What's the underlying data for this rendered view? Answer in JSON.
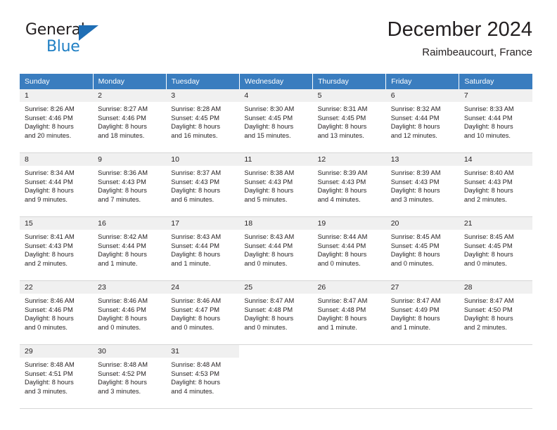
{
  "brand": {
    "name_top": "General",
    "name_bottom": "Blue",
    "triangle_color": "#1f6eb5",
    "blue_color": "#1f7fc4"
  },
  "header": {
    "title": "December 2024",
    "location": "Raimbeaucourt, France"
  },
  "calendar": {
    "header_bg": "#3a7dbf",
    "daynum_bg": "#f0f0f0",
    "weekdays": [
      "Sunday",
      "Monday",
      "Tuesday",
      "Wednesday",
      "Thursday",
      "Friday",
      "Saturday"
    ],
    "weeks": [
      [
        {
          "day": "1",
          "sunrise": "Sunrise: 8:26 AM",
          "sunset": "Sunset: 4:46 PM",
          "daylight1": "Daylight: 8 hours",
          "daylight2": "and 20 minutes."
        },
        {
          "day": "2",
          "sunrise": "Sunrise: 8:27 AM",
          "sunset": "Sunset: 4:46 PM",
          "daylight1": "Daylight: 8 hours",
          "daylight2": "and 18 minutes."
        },
        {
          "day": "3",
          "sunrise": "Sunrise: 8:28 AM",
          "sunset": "Sunset: 4:45 PM",
          "daylight1": "Daylight: 8 hours",
          "daylight2": "and 16 minutes."
        },
        {
          "day": "4",
          "sunrise": "Sunrise: 8:30 AM",
          "sunset": "Sunset: 4:45 PM",
          "daylight1": "Daylight: 8 hours",
          "daylight2": "and 15 minutes."
        },
        {
          "day": "5",
          "sunrise": "Sunrise: 8:31 AM",
          "sunset": "Sunset: 4:45 PM",
          "daylight1": "Daylight: 8 hours",
          "daylight2": "and 13 minutes."
        },
        {
          "day": "6",
          "sunrise": "Sunrise: 8:32 AM",
          "sunset": "Sunset: 4:44 PM",
          "daylight1": "Daylight: 8 hours",
          "daylight2": "and 12 minutes."
        },
        {
          "day": "7",
          "sunrise": "Sunrise: 8:33 AM",
          "sunset": "Sunset: 4:44 PM",
          "daylight1": "Daylight: 8 hours",
          "daylight2": "and 10 minutes."
        }
      ],
      [
        {
          "day": "8",
          "sunrise": "Sunrise: 8:34 AM",
          "sunset": "Sunset: 4:44 PM",
          "daylight1": "Daylight: 8 hours",
          "daylight2": "and 9 minutes."
        },
        {
          "day": "9",
          "sunrise": "Sunrise: 8:36 AM",
          "sunset": "Sunset: 4:43 PM",
          "daylight1": "Daylight: 8 hours",
          "daylight2": "and 7 minutes."
        },
        {
          "day": "10",
          "sunrise": "Sunrise: 8:37 AM",
          "sunset": "Sunset: 4:43 PM",
          "daylight1": "Daylight: 8 hours",
          "daylight2": "and 6 minutes."
        },
        {
          "day": "11",
          "sunrise": "Sunrise: 8:38 AM",
          "sunset": "Sunset: 4:43 PM",
          "daylight1": "Daylight: 8 hours",
          "daylight2": "and 5 minutes."
        },
        {
          "day": "12",
          "sunrise": "Sunrise: 8:39 AM",
          "sunset": "Sunset: 4:43 PM",
          "daylight1": "Daylight: 8 hours",
          "daylight2": "and 4 minutes."
        },
        {
          "day": "13",
          "sunrise": "Sunrise: 8:39 AM",
          "sunset": "Sunset: 4:43 PM",
          "daylight1": "Daylight: 8 hours",
          "daylight2": "and 3 minutes."
        },
        {
          "day": "14",
          "sunrise": "Sunrise: 8:40 AM",
          "sunset": "Sunset: 4:43 PM",
          "daylight1": "Daylight: 8 hours",
          "daylight2": "and 2 minutes."
        }
      ],
      [
        {
          "day": "15",
          "sunrise": "Sunrise: 8:41 AM",
          "sunset": "Sunset: 4:43 PM",
          "daylight1": "Daylight: 8 hours",
          "daylight2": "and 2 minutes."
        },
        {
          "day": "16",
          "sunrise": "Sunrise: 8:42 AM",
          "sunset": "Sunset: 4:44 PM",
          "daylight1": "Daylight: 8 hours",
          "daylight2": "and 1 minute."
        },
        {
          "day": "17",
          "sunrise": "Sunrise: 8:43 AM",
          "sunset": "Sunset: 4:44 PM",
          "daylight1": "Daylight: 8 hours",
          "daylight2": "and 1 minute."
        },
        {
          "day": "18",
          "sunrise": "Sunrise: 8:43 AM",
          "sunset": "Sunset: 4:44 PM",
          "daylight1": "Daylight: 8 hours",
          "daylight2": "and 0 minutes."
        },
        {
          "day": "19",
          "sunrise": "Sunrise: 8:44 AM",
          "sunset": "Sunset: 4:44 PM",
          "daylight1": "Daylight: 8 hours",
          "daylight2": "and 0 minutes."
        },
        {
          "day": "20",
          "sunrise": "Sunrise: 8:45 AM",
          "sunset": "Sunset: 4:45 PM",
          "daylight1": "Daylight: 8 hours",
          "daylight2": "and 0 minutes."
        },
        {
          "day": "21",
          "sunrise": "Sunrise: 8:45 AM",
          "sunset": "Sunset: 4:45 PM",
          "daylight1": "Daylight: 8 hours",
          "daylight2": "and 0 minutes."
        }
      ],
      [
        {
          "day": "22",
          "sunrise": "Sunrise: 8:46 AM",
          "sunset": "Sunset: 4:46 PM",
          "daylight1": "Daylight: 8 hours",
          "daylight2": "and 0 minutes."
        },
        {
          "day": "23",
          "sunrise": "Sunrise: 8:46 AM",
          "sunset": "Sunset: 4:46 PM",
          "daylight1": "Daylight: 8 hours",
          "daylight2": "and 0 minutes."
        },
        {
          "day": "24",
          "sunrise": "Sunrise: 8:46 AM",
          "sunset": "Sunset: 4:47 PM",
          "daylight1": "Daylight: 8 hours",
          "daylight2": "and 0 minutes."
        },
        {
          "day": "25",
          "sunrise": "Sunrise: 8:47 AM",
          "sunset": "Sunset: 4:48 PM",
          "daylight1": "Daylight: 8 hours",
          "daylight2": "and 0 minutes."
        },
        {
          "day": "26",
          "sunrise": "Sunrise: 8:47 AM",
          "sunset": "Sunset: 4:48 PM",
          "daylight1": "Daylight: 8 hours",
          "daylight2": "and 1 minute."
        },
        {
          "day": "27",
          "sunrise": "Sunrise: 8:47 AM",
          "sunset": "Sunset: 4:49 PM",
          "daylight1": "Daylight: 8 hours",
          "daylight2": "and 1 minute."
        },
        {
          "day": "28",
          "sunrise": "Sunrise: 8:47 AM",
          "sunset": "Sunset: 4:50 PM",
          "daylight1": "Daylight: 8 hours",
          "daylight2": "and 2 minutes."
        }
      ],
      [
        {
          "day": "29",
          "sunrise": "Sunrise: 8:48 AM",
          "sunset": "Sunset: 4:51 PM",
          "daylight1": "Daylight: 8 hours",
          "daylight2": "and 3 minutes."
        },
        {
          "day": "30",
          "sunrise": "Sunrise: 8:48 AM",
          "sunset": "Sunset: 4:52 PM",
          "daylight1": "Daylight: 8 hours",
          "daylight2": "and 3 minutes."
        },
        {
          "day": "31",
          "sunrise": "Sunrise: 8:48 AM",
          "sunset": "Sunset: 4:53 PM",
          "daylight1": "Daylight: 8 hours",
          "daylight2": "and 4 minutes."
        },
        {
          "day": "",
          "sunrise": "",
          "sunset": "",
          "daylight1": "",
          "daylight2": ""
        },
        {
          "day": "",
          "sunrise": "",
          "sunset": "",
          "daylight1": "",
          "daylight2": ""
        },
        {
          "day": "",
          "sunrise": "",
          "sunset": "",
          "daylight1": "",
          "daylight2": ""
        },
        {
          "day": "",
          "sunrise": "",
          "sunset": "",
          "daylight1": "",
          "daylight2": ""
        }
      ]
    ]
  }
}
